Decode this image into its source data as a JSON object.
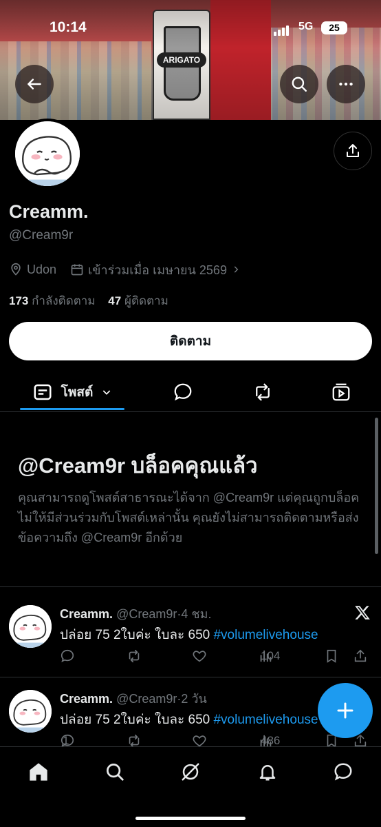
{
  "status_bar": {
    "time": "10:14",
    "network": "5G",
    "battery": "25"
  },
  "profile": {
    "name": "Creamm.",
    "handle": "@Cream9r",
    "location": "Udon",
    "joined": "เข้าร่วมเมื่อ เมษายน 2569",
    "following_count": "173",
    "following_label": "กำลังติดตาม",
    "followers_count": "47",
    "followers_label": "ผู้ติดตาม",
    "follow_button": "ติดตาม"
  },
  "tabs": {
    "posts_label": "โพสต์"
  },
  "blocked_notice": {
    "title": "@Cream9r บล็อคคุณแล้ว",
    "description": "คุณสามารถดูโพสต์สาธารณะได้จาก @Cream9r แต่คุณถูกบล็อคไม่ให้มีส่วนร่วมกับโพสต์เหล่านั้น คุณยังไม่สามารถติดตามหรือส่งข้อความถึง @Cream9r อีกด้วย"
  },
  "tweets": [
    {
      "name": "Creamm.",
      "handle": "@Cream9r",
      "time": "4 ชม.",
      "text": "ปล่อย 75 2ใบค่ะ ใบละ 650 ",
      "hashtag": "#volumelivehouse",
      "replies": "",
      "views": "104"
    },
    {
      "name": "Creamm.",
      "handle": "@Cream9r",
      "time": "2 วัน",
      "text": "ปล่อย 75 2ใบค่ะ ใบละ 650 ",
      "hashtag": "#volumelivehouse",
      "replies": "1",
      "views": "486"
    }
  ],
  "colors": {
    "accent": "#1d9bf0",
    "muted": "#71767b",
    "divider": "#2f3336"
  }
}
